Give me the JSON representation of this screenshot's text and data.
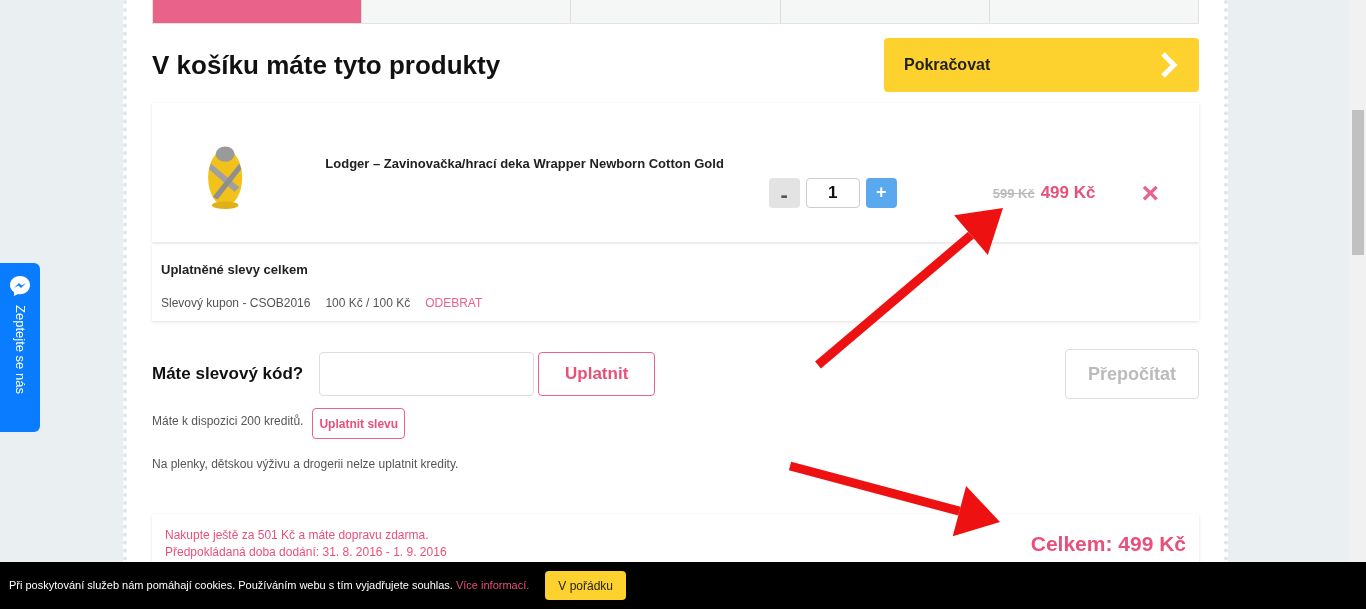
{
  "steps": [
    {
      "selected": true
    },
    {
      "selected": false
    },
    {
      "selected": false
    },
    {
      "selected": false
    },
    {
      "selected": false
    }
  ],
  "heading": "V košíku máte tyto produkty",
  "continue_button": "Pokračovat",
  "product": {
    "kind": "picture",
    "name": "Lodger – Zavinovačka/hrací deka Wrapper Newborn Cotton Gold",
    "quantity": "1",
    "minus": {
      "label": "-",
      "disabled": true
    },
    "plus": {
      "label": "+",
      "disabled": false
    },
    "old_price": "599 Kč",
    "price": "499 Kč",
    "remove": "×"
  },
  "discounts": {
    "title": "Uplatněné slevy celkem",
    "items": [
      {
        "name": "Slevový kupon - CSOB2016",
        "amount": "100 Kč / 100 Kč",
        "action": "ODEBRAT"
      }
    ]
  },
  "coupon": {
    "label": "Máte slevový kód?",
    "apply": "Uplatnit",
    "recalculate": {
      "label": "Přepočítat",
      "disabled": true
    }
  },
  "credits": {
    "text": "Máte k dispozici 200 kreditů.",
    "apply": "Uplatnit slevu",
    "note": "Na plenky, dětskou výživu a drogerii nelze uplatnit kredity."
  },
  "summary": {
    "lines": [
      "Nakupte ještě za 501 Kč a máte dopravu zdarma.",
      "Předpokládaná doba dodání: 31. 8. 2016 - 1. 9. 2016"
    ],
    "total": "Celkem: 499 Kč"
  },
  "chat_tab": "Zeptejte se nás",
  "cookie_bar": {
    "text": "Při poskytování služeb nám pomáhají cookies. Používáním webu s tím vyjadřujete souhlas.",
    "link": "Více informací.",
    "button": "V pořádku"
  }
}
